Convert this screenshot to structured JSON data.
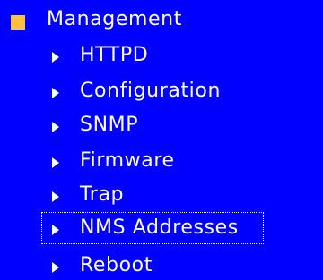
{
  "menu": {
    "header": {
      "label": "Management",
      "icon": "square-icon",
      "icon_color": "#ffc040"
    },
    "items": [
      {
        "label": "HTTPD",
        "icon": "triangle-right-icon",
        "focused": false
      },
      {
        "label": "Configuration",
        "icon": "triangle-right-icon",
        "focused": false
      },
      {
        "label": "SNMP",
        "icon": "triangle-right-icon",
        "focused": false
      },
      {
        "label": "Firmware",
        "icon": "triangle-right-icon",
        "focused": false
      },
      {
        "label": "Trap",
        "icon": "triangle-right-icon",
        "focused": false
      },
      {
        "label": "NMS Addresses",
        "icon": "triangle-right-icon",
        "focused": true
      },
      {
        "label": "Reboot",
        "icon": "triangle-right-icon",
        "focused": false
      }
    ]
  },
  "colors": {
    "background": "#0000ff",
    "text": "#ffffff",
    "accent": "#ffc040"
  }
}
